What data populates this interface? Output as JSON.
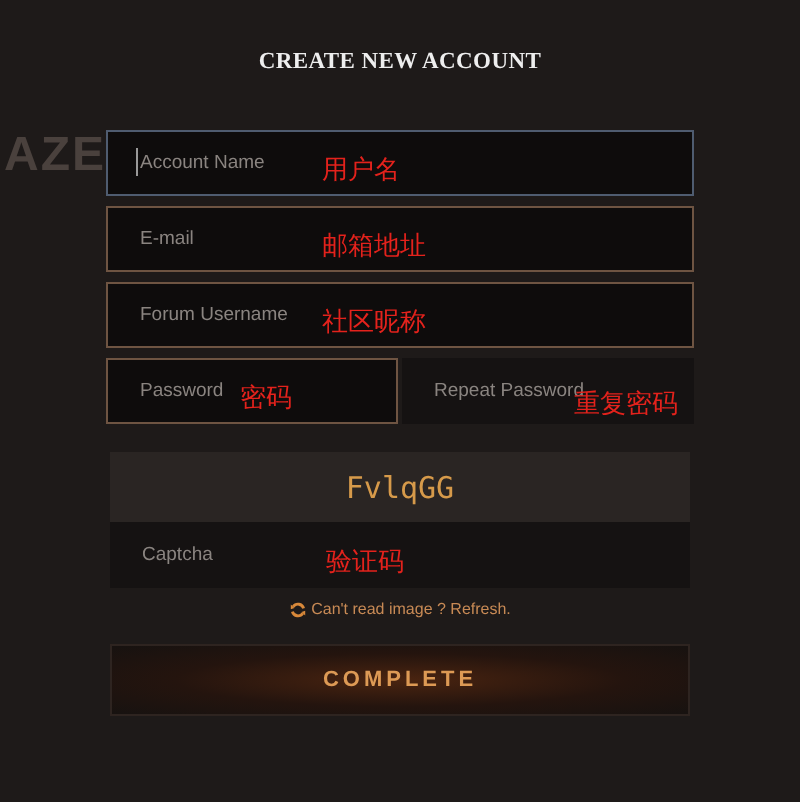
{
  "background_text": "AZE",
  "title": "CREATE NEW ACCOUNT",
  "fields": [
    {
      "placeholder": "Account Name",
      "annotation": "用户名",
      "kind": "outlined",
      "focused": true
    },
    {
      "placeholder": "E-mail",
      "annotation": "邮箱地址",
      "kind": "outlined",
      "focused": false
    },
    {
      "placeholder": "Forum Username",
      "annotation": "社区昵称",
      "kind": "outlined",
      "focused": false
    }
  ],
  "password_row": [
    {
      "placeholder": "Password",
      "annotation": "密码",
      "kind": "outlined",
      "focused": false
    },
    {
      "placeholder": "Repeat Password",
      "annotation": "重复密码",
      "kind": "filled",
      "focused": false
    }
  ],
  "captcha": {
    "image_text": "FvlqGG",
    "field": {
      "placeholder": "Captcha",
      "annotation": "验证码",
      "kind": "filled",
      "focused": false
    },
    "refresh_link": "Can't read image ? Refresh."
  },
  "button": "COMPLETE"
}
